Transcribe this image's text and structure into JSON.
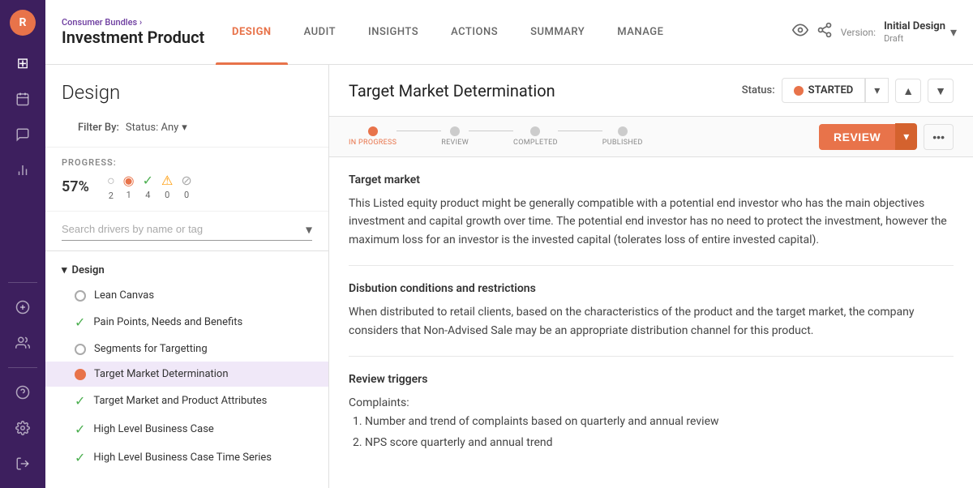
{
  "sidebar": {
    "avatar_text": "R",
    "icons": [
      {
        "name": "home-icon",
        "symbol": "⊞",
        "active": false
      },
      {
        "name": "calendar-icon",
        "symbol": "▦",
        "active": false
      },
      {
        "name": "chat-icon",
        "symbol": "💬",
        "active": false
      },
      {
        "name": "chart-icon",
        "symbol": "📊",
        "active": false
      },
      {
        "name": "add-icon",
        "symbol": "+",
        "active": false
      },
      {
        "name": "team-icon",
        "symbol": "👥",
        "active": false
      },
      {
        "name": "help-icon",
        "symbol": "?",
        "active": false
      },
      {
        "name": "settings-icon",
        "symbol": "⚙",
        "active": false
      },
      {
        "name": "logout-icon",
        "symbol": "→",
        "active": false
      }
    ]
  },
  "header": {
    "breadcrumb": "Consumer Bundles ›",
    "title": "Investment Product",
    "tabs": [
      {
        "label": "DESIGN",
        "active": true
      },
      {
        "label": "AUDIT",
        "active": false
      },
      {
        "label": "INSIGHTS",
        "active": false
      },
      {
        "label": "ACTIONS",
        "active": false
      },
      {
        "label": "SUMMARY",
        "active": false
      },
      {
        "label": "MANAGE",
        "active": false
      }
    ],
    "version_label": "Version:",
    "version_name": "Initial Design",
    "version_sub": "Draft"
  },
  "design": {
    "title": "Design",
    "filter_label": "Filter By:",
    "filter_value": "Status: Any",
    "progress_label": "PROGRESS:",
    "progress_pct": "57%",
    "progress_icons": [
      {
        "icon": "○",
        "count": "2",
        "color": "#aaa"
      },
      {
        "icon": "◉",
        "count": "1",
        "color": "#e8734a"
      },
      {
        "icon": "✓",
        "count": "4",
        "color": "#4caf50"
      },
      {
        "icon": "⚠",
        "count": "0",
        "color": "#ff9800"
      },
      {
        "icon": "⊘",
        "count": "0",
        "color": "#aaa"
      }
    ],
    "search_placeholder": "Search drivers by name or tag",
    "section_name": "Design",
    "drivers": [
      {
        "label": "Lean Canvas",
        "status": "circle",
        "active": false
      },
      {
        "label": "Pain Points, Needs and Benefits",
        "status": "check",
        "active": false
      },
      {
        "label": "Segments for Targetting",
        "status": "circle",
        "active": false
      },
      {
        "label": "Target Market Determination",
        "status": "orange",
        "active": true
      },
      {
        "label": "Target Market and Product Attributes",
        "status": "check",
        "active": false
      },
      {
        "label": "High Level Business Case",
        "status": "check",
        "active": false
      },
      {
        "label": "High Level Business Case Time Series",
        "status": "check",
        "active": false
      }
    ]
  },
  "right_panel": {
    "title": "Target Market Determination",
    "status_label": "STARTED",
    "steps": [
      {
        "label": "IN PROGRESS",
        "active": true
      },
      {
        "label": "REVIEW",
        "active": false
      },
      {
        "label": "COMPLETED",
        "active": false
      },
      {
        "label": "PUBLISHED",
        "active": false
      }
    ],
    "review_btn": "REVIEW",
    "sections": [
      {
        "id": "target_market",
        "title": "Target market",
        "text": "This Listed equity product might be generally compatible with a potential end investor who has the main objectives investment and capital growth over time.   The potential end investor has no need to protect the investment, however the maximum loss for an investor is the invested capital (tolerates loss of entire invested capital)."
      },
      {
        "id": "disbution",
        "title": "Disbution conditions and restrictions",
        "text": "When distributed to retail clients, based on the characteristics of the product and the target market, the company considers that Non-Advised Sale may be an appropriate distribution channel for this product."
      },
      {
        "id": "review_triggers",
        "title": "Review triggers",
        "intro": "Complaints:",
        "items": [
          "Number and trend of complaints based on quarterly and annual review",
          "NPS score quarterly and annual trend"
        ]
      }
    ]
  }
}
